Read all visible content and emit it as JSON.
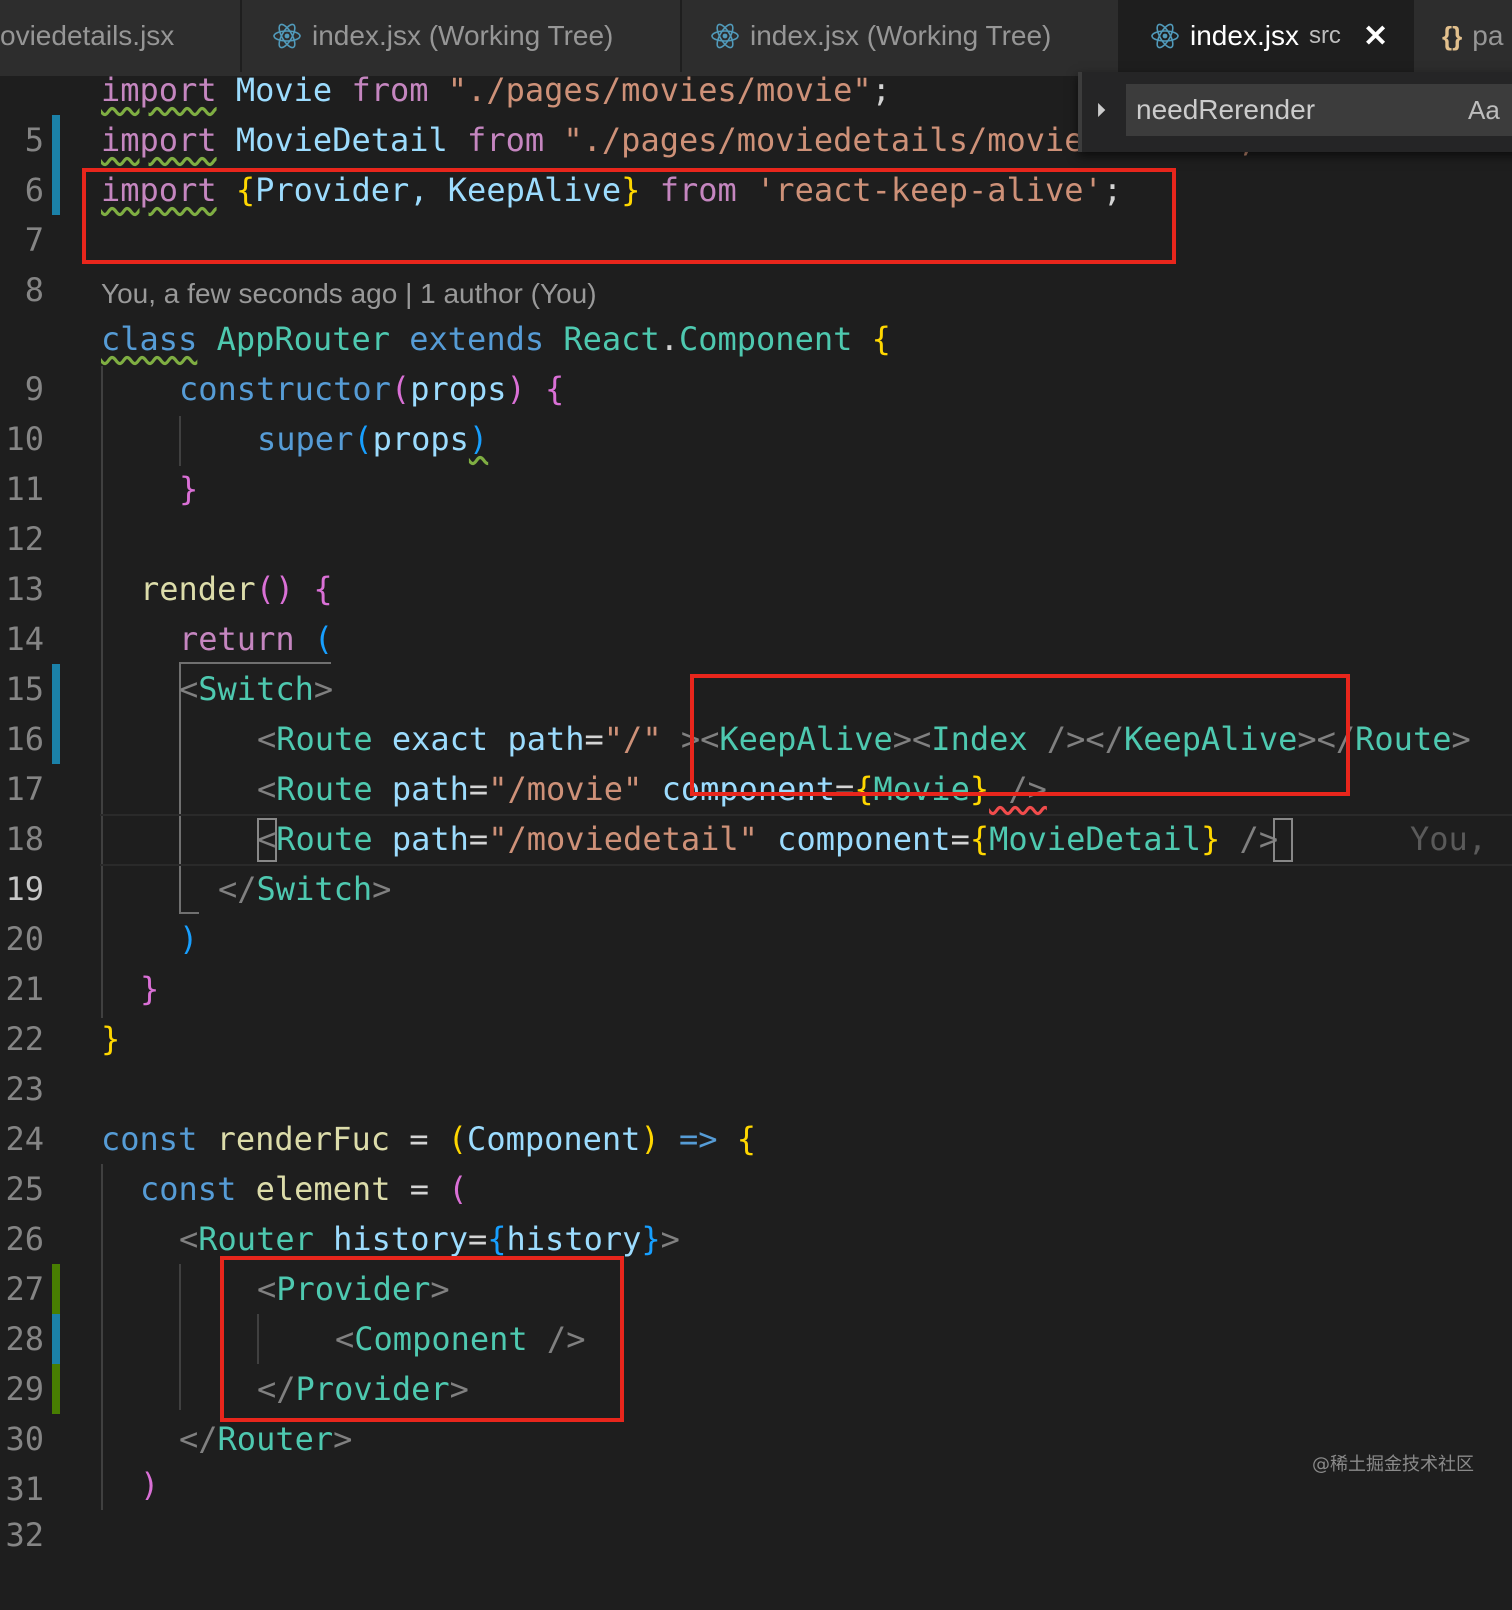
{
  "tabs": [
    {
      "name": "oviedetails.jsx",
      "suffix": "",
      "active": false,
      "icon": "none"
    },
    {
      "name": "index.jsx (Working Tree)",
      "suffix": "",
      "active": false,
      "icon": "react-icon"
    },
    {
      "name": "index.jsx (Working Tree)",
      "suffix": "",
      "active": false,
      "icon": "react-icon"
    },
    {
      "name": "index.jsx",
      "suffix": "src",
      "active": true,
      "icon": "react-icon"
    },
    {
      "name": "pa",
      "suffix": "",
      "active": false,
      "icon": "json-braces-icon"
    }
  ],
  "tab_close_glyph": "✕",
  "json_braces_glyph": "{}",
  "find": {
    "query": "needRerender",
    "toggle_glyph": "⏵",
    "match_case_label": "Aa"
  },
  "blame": "You, a few seconds ago | 1 author (You)",
  "ghost_blame": "You, ",
  "line_numbers": [
    "5",
    "6",
    "7",
    "8",
    "9",
    "10",
    "11",
    "12",
    "13",
    "14",
    "15",
    "16",
    "17",
    "18",
    "19",
    "20",
    "21",
    "22",
    "23",
    "24",
    "25",
    "26",
    "27",
    "28",
    "29",
    "30",
    "31",
    "32"
  ],
  "code": {
    "l5": [
      "import",
      " Movie ",
      "from",
      " \"./pages/movies/movie\"",
      ";"
    ],
    "l6": [
      "import",
      " MovieDetail ",
      "from",
      " \"./pages/moviedetails/movi",
      "edetails\";"
    ],
    "l7": [
      "import",
      " {",
      "Provider, KeepAlive",
      "}",
      " from ",
      "'react-keep-alive'",
      ";"
    ],
    "l9": [
      "class",
      " ",
      "AppRouter",
      " extends ",
      "React",
      ".",
      "Component",
      " {"
    ],
    "l10": [
      "constructor",
      "(",
      "props",
      ")",
      " {"
    ],
    "l11": [
      "super",
      "(",
      "props",
      ")"
    ],
    "l12": [
      "}"
    ],
    "l14": [
      "render",
      "()",
      " {"
    ],
    "l15": [
      "return",
      " ("
    ],
    "l16": [
      "<",
      "Switch",
      ">"
    ],
    "l17": [
      "<",
      "Route",
      " exact",
      " path",
      "=",
      "\"/\"",
      " >",
      "<",
      "KeepAlive",
      ">",
      "<",
      "Index",
      " />",
      "</",
      "KeepAlive",
      ">",
      "</",
      "Route",
      ">"
    ],
    "l18": [
      "<",
      "Route",
      " path",
      "=",
      "\"/movie\"",
      " component",
      "=",
      "{",
      "Movie",
      "}",
      " />"
    ],
    "l19": [
      "<",
      "Route",
      " path",
      "=",
      "\"/moviedetail\"",
      " component",
      "=",
      "{",
      "MovieDetail",
      "}",
      " />"
    ],
    "l20": [
      "</",
      "Switch",
      ">"
    ],
    "l21": [
      ")"
    ],
    "l22": [
      "}"
    ],
    "l23": [
      "}"
    ],
    "l25": [
      "const",
      " renderFuc ",
      "=",
      " (",
      "Component",
      ")",
      " =>",
      " {"
    ],
    "l26": [
      "const",
      " element ",
      "=",
      " ("
    ],
    "l27": [
      "<",
      "Router",
      " history",
      "=",
      "{",
      "history",
      "}",
      ">"
    ],
    "l28": [
      "<",
      "Provider",
      ">"
    ],
    "l29": [
      "<",
      "Component",
      " />"
    ],
    "l30": [
      "</",
      "Provider",
      ">"
    ],
    "l31": [
      "</",
      "Router",
      ">"
    ],
    "l32": [
      ")"
    ]
  },
  "watermark": "@稀土掘金技术社区",
  "colors": {
    "highlight_box": "#e8261c",
    "background": "#1e1e1e"
  }
}
